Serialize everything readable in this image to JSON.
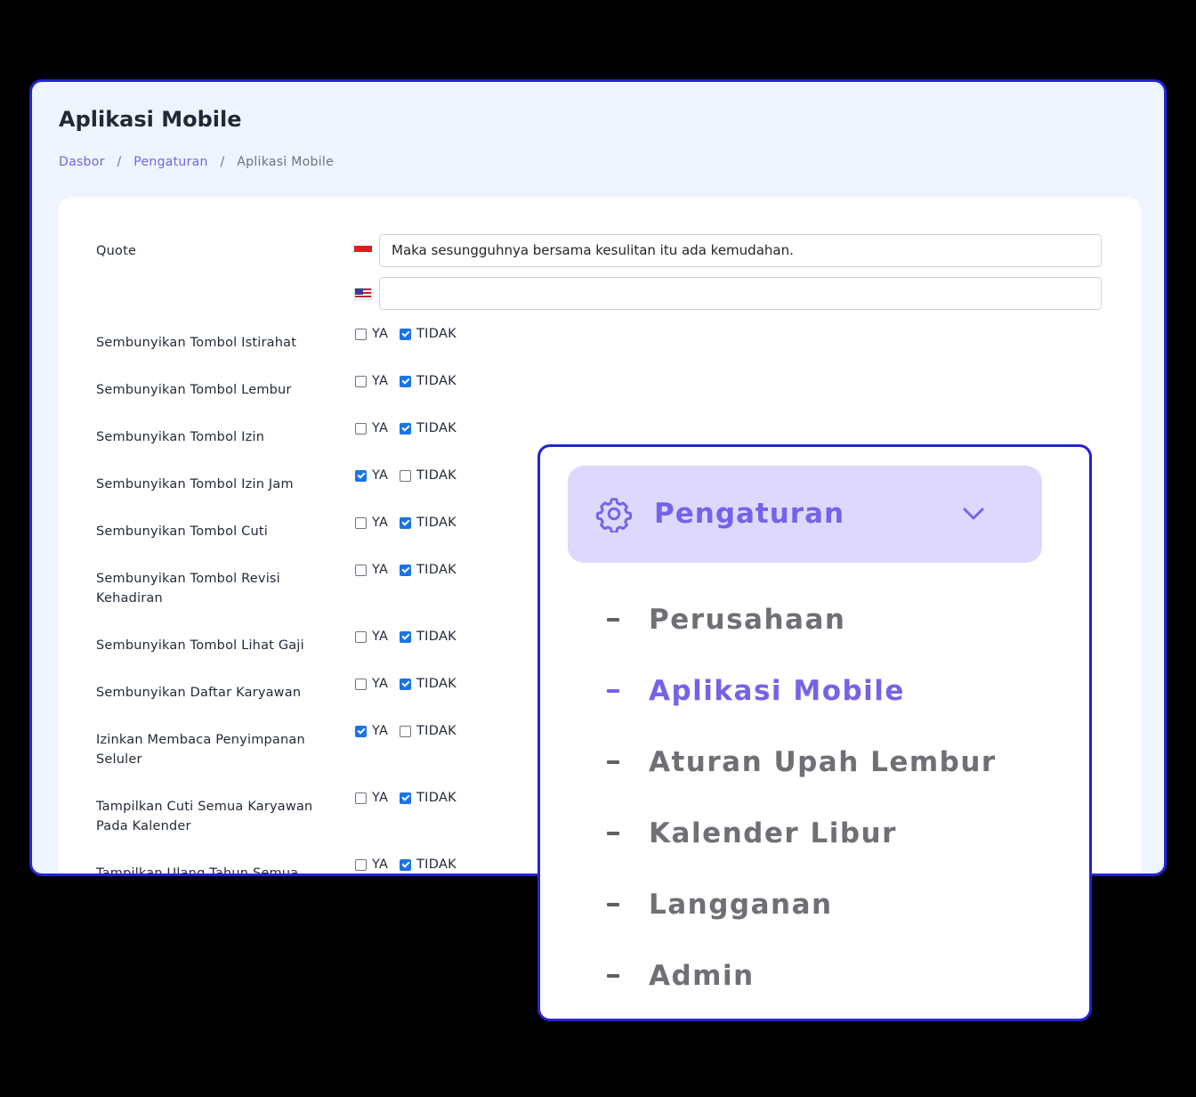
{
  "page": {
    "title": "Aplikasi Mobile"
  },
  "breadcrumb": [
    "Dasbor",
    "Pengaturan",
    "Aplikasi Mobile"
  ],
  "breadcrumb_separator": "/",
  "form": {
    "quote_label": "Quote",
    "quote_id_value": "Maka sesungguhnya bersama kesulitan itu ada kemudahan.",
    "quote_en_value": "",
    "yes_label": "YA",
    "no_label": "TIDAK",
    "rows": [
      {
        "label": "Sembunyikan Tombol Istirahat",
        "value": "TIDAK"
      },
      {
        "label": "Sembunyikan Tombol Lembur",
        "value": "TIDAK"
      },
      {
        "label": "Sembunyikan Tombol Izin",
        "value": "TIDAK"
      },
      {
        "label": "Sembunyikan Tombol Izin Jam",
        "value": "YA"
      },
      {
        "label": "Sembunyikan Tombol Cuti",
        "value": "TIDAK"
      },
      {
        "label": "Sembunyikan Tombol Revisi Kehadiran",
        "value": "TIDAK"
      },
      {
        "label": "Sembunyikan Tombol Lihat Gaji",
        "value": "TIDAK"
      },
      {
        "label": "Sembunyikan Daftar Karyawan",
        "value": "TIDAK"
      },
      {
        "label": "Izinkan Membaca Penyimpanan Seluler",
        "value": "YA"
      },
      {
        "label": "Tampilkan Cuti Semua Karyawan Pada Kalender",
        "value": "TIDAK"
      },
      {
        "label": "Tampilkan Ulang Tahun Semua",
        "value": "TIDAK"
      }
    ]
  },
  "menu": {
    "header_label": "Pengaturan",
    "header_icon": "gear-icon",
    "items": [
      {
        "label": "Perusahaan",
        "active": false
      },
      {
        "label": "Aplikasi Mobile",
        "active": true
      },
      {
        "label": "Aturan Upah Lembur",
        "active": false
      },
      {
        "label": "Kalender Libur",
        "active": false
      },
      {
        "label": "Langganan",
        "active": false
      },
      {
        "label": "Admin",
        "active": false
      }
    ]
  },
  "colors": {
    "accent": "#7463ea",
    "frame_border": "#2323d6",
    "checkbox_checked": "#1a73e8",
    "menu_header_bg": "#dcd9fc"
  }
}
